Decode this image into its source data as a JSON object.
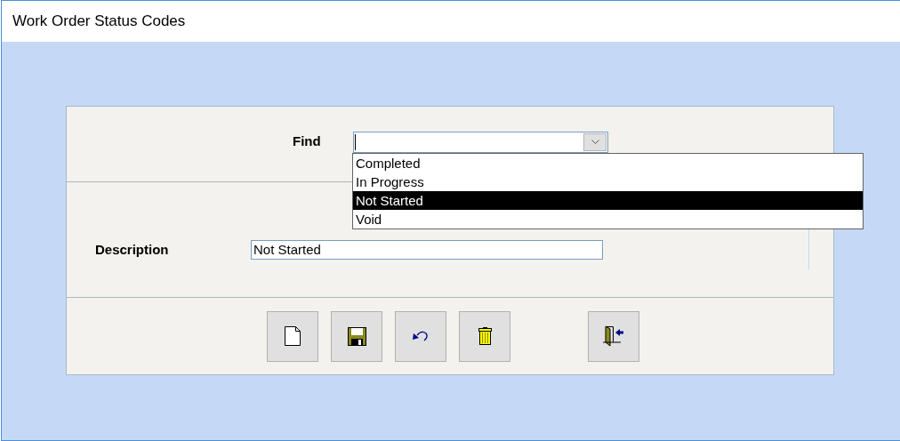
{
  "window": {
    "title": "Work Order Status Codes"
  },
  "find": {
    "label": "Find",
    "expanded": true,
    "options": [
      {
        "label": "Completed",
        "selected": false
      },
      {
        "label": "In Progress",
        "selected": false
      },
      {
        "label": "Not Started",
        "selected": true
      },
      {
        "label": "Void",
        "selected": false
      }
    ]
  },
  "description": {
    "label": "Description",
    "value": "Not Started"
  },
  "buttons": [
    {
      "kind": "new"
    },
    {
      "kind": "save"
    },
    {
      "kind": "undo"
    },
    {
      "kind": "delete"
    },
    {
      "kind": "exit"
    }
  ]
}
